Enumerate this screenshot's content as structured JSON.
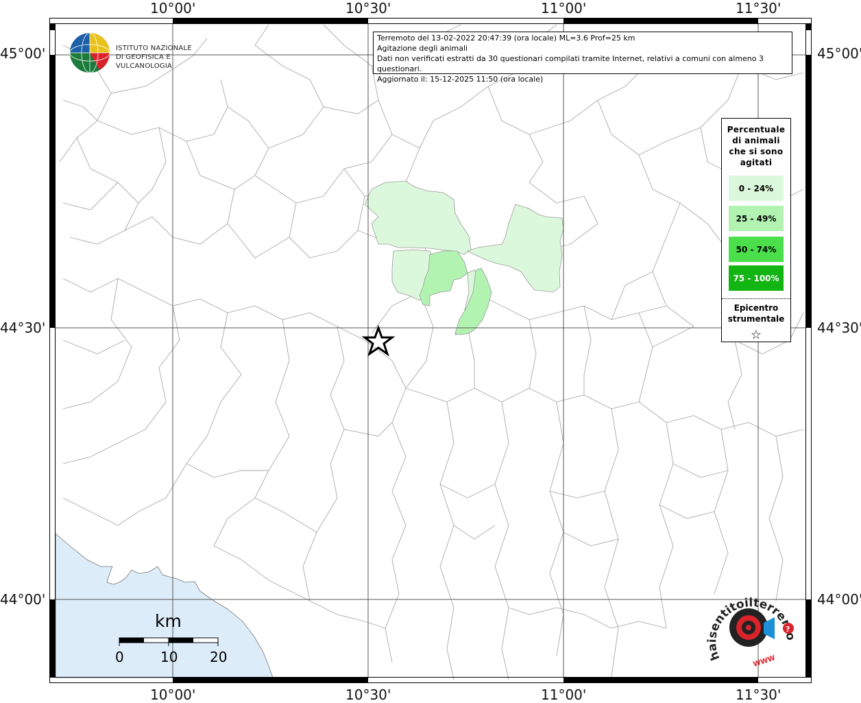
{
  "map": {
    "coords": {
      "top": [
        "10°00'",
        "10°30'",
        "11°00'",
        "11°30'"
      ],
      "bottom": [
        "10°00'",
        "10°30'",
        "11°00'",
        "11°30'"
      ],
      "left": [
        "45°00'",
        "44°30'",
        "44°00'"
      ],
      "right": [
        "45°00'",
        "44°30'",
        "44°00'"
      ]
    },
    "colors": {
      "sea": "#dcecf8",
      "frame": "#000000",
      "border_lines": "#a0a0a0",
      "grid": "#555555"
    }
  },
  "info": {
    "line1": "Terremoto del 13-02-2022 20:47:39 (ora locale) ML=3.6 Prof=25 km",
    "line2": "Agitazione degli animali",
    "line3": "Dati non verificati estratti da 30 questionari compilati tramite Internet, relativi a comuni con almeno 3 questionari.",
    "line4": "Aggiornato il: 15-12-2025 11:50 (ora locale)"
  },
  "logo": {
    "ingv_line1": "ISTITUTO NAZIONALE",
    "ingv_line2": "DI GEOFISICA E VULCANOLOGIA",
    "hst_text": "haisentitoilterremoto.it",
    "hst_www": "WWW"
  },
  "legend": {
    "title": [
      "Percentuale",
      "di animali",
      "che si sono",
      "agitati"
    ],
    "classes": [
      {
        "label": "0 - 24%",
        "color": "#dcf8dc"
      },
      {
        "label": "25 - 49%",
        "color": "#b2f3b2"
      },
      {
        "label": "50 - 74%",
        "color": "#4cdf4c"
      },
      {
        "label": "75 - 100%",
        "color": "#12b512"
      }
    ],
    "epicenter_line1": "Epicentro",
    "epicenter_line2": "strumentale",
    "star_symbol": "☆"
  },
  "scale": {
    "unit": "km",
    "ticks": [
      "0",
      "10",
      "20"
    ]
  }
}
